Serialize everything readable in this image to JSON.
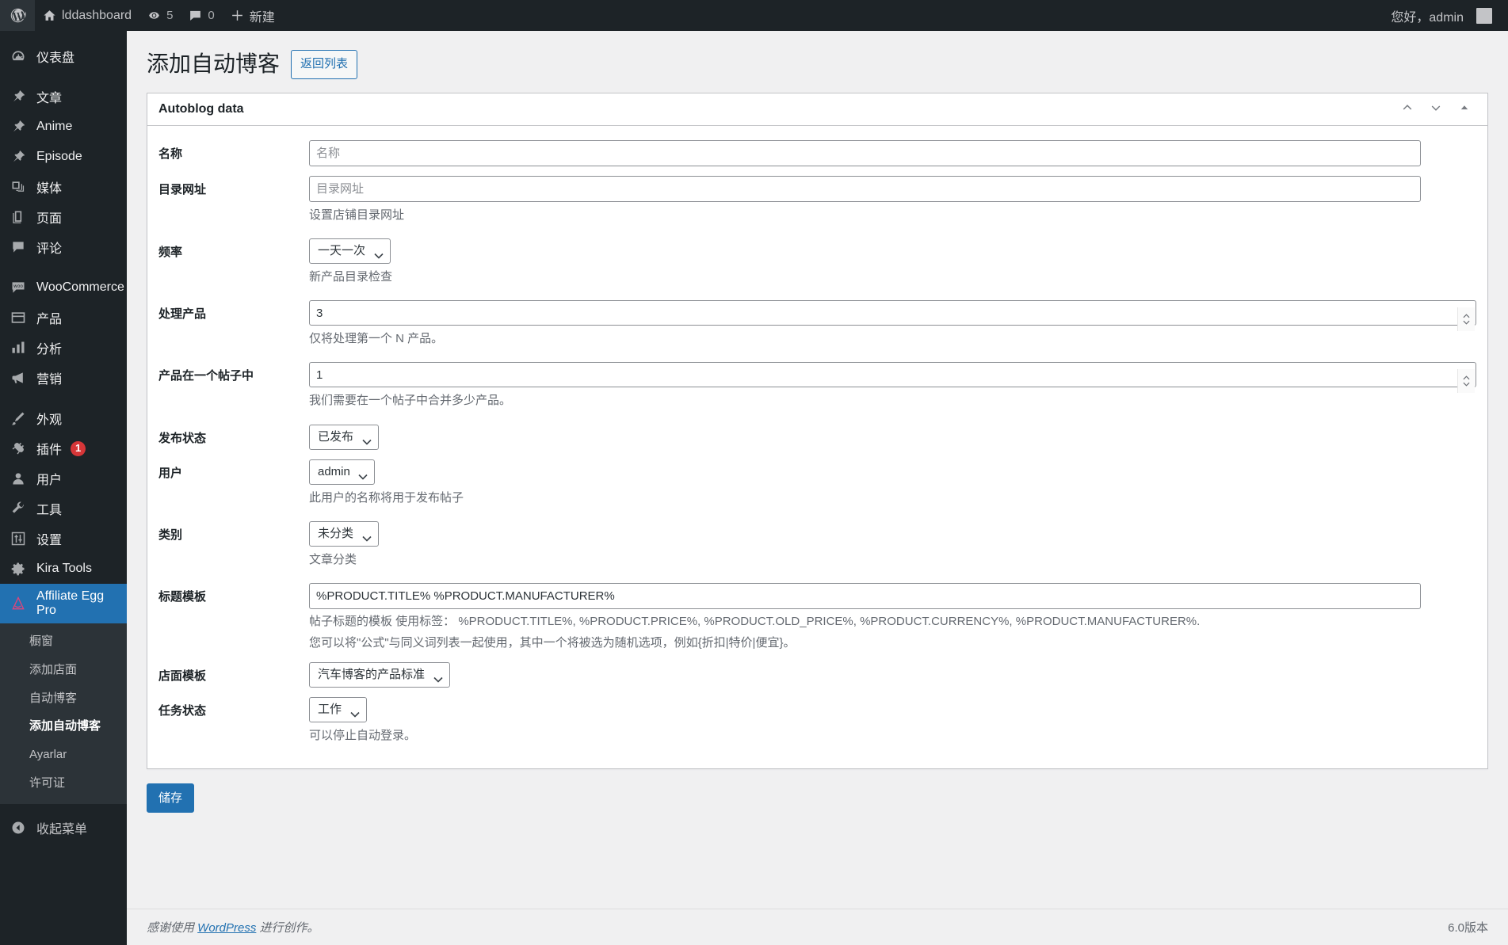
{
  "adminbar": {
    "wp_logo_title": "关于 WordPress",
    "site_name": "lddashboard",
    "updates_count": "5",
    "comments_count": "0",
    "new_label": "新建",
    "greeting": "您好，admin"
  },
  "sidebar": {
    "items": [
      {
        "label": "仪表盘",
        "icon": "dashboard-icon",
        "sep_after": true
      },
      {
        "label": "文章",
        "icon": "pin-icon",
        "sep_after": false
      },
      {
        "label": "Anime",
        "icon": "pin-icon",
        "sep_after": false
      },
      {
        "label": "Episode",
        "icon": "pin-icon",
        "sep_after": false
      },
      {
        "label": "媒体",
        "icon": "media-icon",
        "sep_after": false
      },
      {
        "label": "页面",
        "icon": "page-icon",
        "sep_after": false
      },
      {
        "label": "评论",
        "icon": "comment-icon",
        "sep_after": true
      },
      {
        "label": "WooCommerce",
        "icon": "woocommerce-icon",
        "sep_after": false
      },
      {
        "label": "产品",
        "icon": "product-icon",
        "sep_after": false
      },
      {
        "label": "分析",
        "icon": "analytics-icon",
        "sep_after": false
      },
      {
        "label": "营销",
        "icon": "marketing-megaphone-icon",
        "sep_after": true
      },
      {
        "label": "外观",
        "icon": "appearance-brush-icon",
        "sep_after": false
      },
      {
        "label": "插件",
        "icon": "plugins-plug-icon",
        "badge": "1",
        "sep_after": false
      },
      {
        "label": "用户",
        "icon": "users-icon",
        "sep_after": false
      },
      {
        "label": "工具",
        "icon": "tools-wrench-icon",
        "sep_after": false
      },
      {
        "label": "设置",
        "icon": "settings-sliders-icon",
        "sep_after": false
      },
      {
        "label": "Kira Tools",
        "icon": "gear-icon",
        "sep_after": false
      },
      {
        "label": "Affiliate Egg Pro",
        "icon": "affiliate-egg-icon",
        "current": true,
        "sep_after": false
      }
    ],
    "submenu": [
      {
        "label": "橱窗",
        "current": false
      },
      {
        "label": "添加店面",
        "current": false
      },
      {
        "label": "自动博客",
        "current": false
      },
      {
        "label": "添加自动博客",
        "current": true
      },
      {
        "label": "Ayarlar",
        "current": false
      },
      {
        "label": "许可证",
        "current": false
      }
    ],
    "collapse_label": "收起菜单"
  },
  "page": {
    "title": "添加自动博客",
    "title_action": "返回列表"
  },
  "postbox": {
    "title": "Autoblog data",
    "actions": {
      "move_up": "chevron-up-icon",
      "move_down": "chevron-down-icon",
      "toggle": "toggle-triangle-icon"
    }
  },
  "form": {
    "name": {
      "label": "名称",
      "placeholder": "名称",
      "value": ""
    },
    "catalog_url": {
      "label": "目录网址",
      "placeholder": "目录网址",
      "value": "",
      "desc": "设置店铺目录网址"
    },
    "frequency": {
      "label": "频率",
      "selected": "一天一次",
      "options": [
        "一天一次"
      ],
      "desc": "新产品目录检查"
    },
    "process_products": {
      "label": "处理产品",
      "value": "3",
      "desc": "仅将处理第一个 N 产品。"
    },
    "products_in_post": {
      "label": "产品在一个帖子中",
      "value": "1",
      "desc": "我们需要在一个帖子中合并多少产品。"
    },
    "post_status": {
      "label": "发布状态",
      "selected": "已发布",
      "options": [
        "已发布"
      ]
    },
    "user": {
      "label": "用户",
      "selected": "admin",
      "options": [
        "admin"
      ],
      "desc": "此用户的名称将用于发布帖子"
    },
    "category": {
      "label": "类别",
      "selected": "未分类",
      "options": [
        "未分类"
      ],
      "desc": "文章分类"
    },
    "title_template": {
      "label": "标题模板",
      "value": "%PRODUCT.TITLE% %PRODUCT.MANUFACTURER%",
      "desc_line1": "帖子标题的模板 使用标签： %PRODUCT.TITLE%, %PRODUCT.PRICE%, %PRODUCT.OLD_PRICE%, %PRODUCT.CURRENCY%, %PRODUCT.MANUFACTURER%.",
      "desc_line2": "您可以将\"公式\"与同义词列表一起使用，其中一个将被选为随机选项，例如{折扣|特价|便宜}。"
    },
    "storefront_template": {
      "label": "店面模板",
      "selected": "汽车博客的产品标准",
      "options": [
        "汽车博客的产品标准"
      ]
    },
    "task_status": {
      "label": "任务状态",
      "selected": "工作",
      "options": [
        "工作"
      ],
      "desc": "可以停止自动登录。"
    },
    "submit_label": "储存"
  },
  "footer": {
    "thanks_prefix": "感谢使用 ",
    "wordpress_link": "WordPress",
    "thanks_suffix": " 进行创作。",
    "version": "6.0版本"
  },
  "colors": {
    "admin_bar_bg": "#1d2327",
    "menu_bg": "#1d2327",
    "submenu_bg": "#2c3338",
    "accent_blue": "#2271b1",
    "badge_red": "#d63638",
    "body_bg": "#f0f0f1"
  }
}
